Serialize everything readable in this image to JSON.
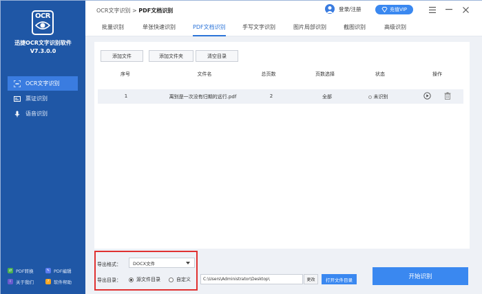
{
  "app": {
    "logo_text": "OCR",
    "name": "迅捷OCR文字识别软件",
    "version": "V7.3.0.0"
  },
  "sidebar": {
    "items": [
      {
        "label": "OCR文字识别",
        "icon": "ocr-scan-icon",
        "active": true
      },
      {
        "label": "票证识别",
        "icon": "card-icon",
        "active": false
      },
      {
        "label": "语音识别",
        "icon": "microphone-icon",
        "active": false
      }
    ],
    "footer": [
      {
        "label": "PDF转换",
        "color": "#4caf50"
      },
      {
        "label": "PDF编辑",
        "color": "#5b7cf0"
      },
      {
        "label": "关于我们",
        "color": "#6a5acd"
      },
      {
        "label": "软件帮助",
        "color": "#f5a623"
      }
    ]
  },
  "topbar": {
    "breadcrumb_root": "OCR文字识别",
    "breadcrumb_sep": ">",
    "breadcrumb_current": "PDF文档识别",
    "login": "登录/注册",
    "vip": "充值VIP"
  },
  "tabs": [
    {
      "label": "批量识别",
      "active": false
    },
    {
      "label": "单张快速识别",
      "active": false
    },
    {
      "label": "PDF文档识别",
      "active": true
    },
    {
      "label": "手写文字识别",
      "active": false
    },
    {
      "label": "图片局部识别",
      "active": false
    },
    {
      "label": "截图识别",
      "active": false
    },
    {
      "label": "高级识别",
      "active": false
    }
  ],
  "toolbar": {
    "add_file": "添加文件",
    "add_folder": "添加文件夹",
    "clear": "清空目录"
  },
  "table": {
    "headers": {
      "index": "序号",
      "filename": "文件名",
      "pages": "总页数",
      "page_select": "页数选择",
      "status": "状态",
      "action": "操作"
    },
    "rows": [
      {
        "index": "1",
        "filename": "离别是一次没有归期的远行.pdf",
        "pages": "2",
        "page_select": "全部",
        "status": "未识别"
      }
    ]
  },
  "export": {
    "format_label": "导出格式：",
    "format_value": "DOCX文件",
    "dir_label": "导出目录：",
    "option_source": "源文件目录",
    "option_custom": "自定义",
    "selected_option": "source",
    "path": "C:\\Users\\Administrator\\Desktop\\",
    "change_button": "更改",
    "open_folder_button": "打开文件目录",
    "start_button": "开始识别"
  },
  "colors": {
    "sidebar_bg": "#1f57a6",
    "accent": "#3a88f0",
    "highlight_border": "#e0302f"
  }
}
